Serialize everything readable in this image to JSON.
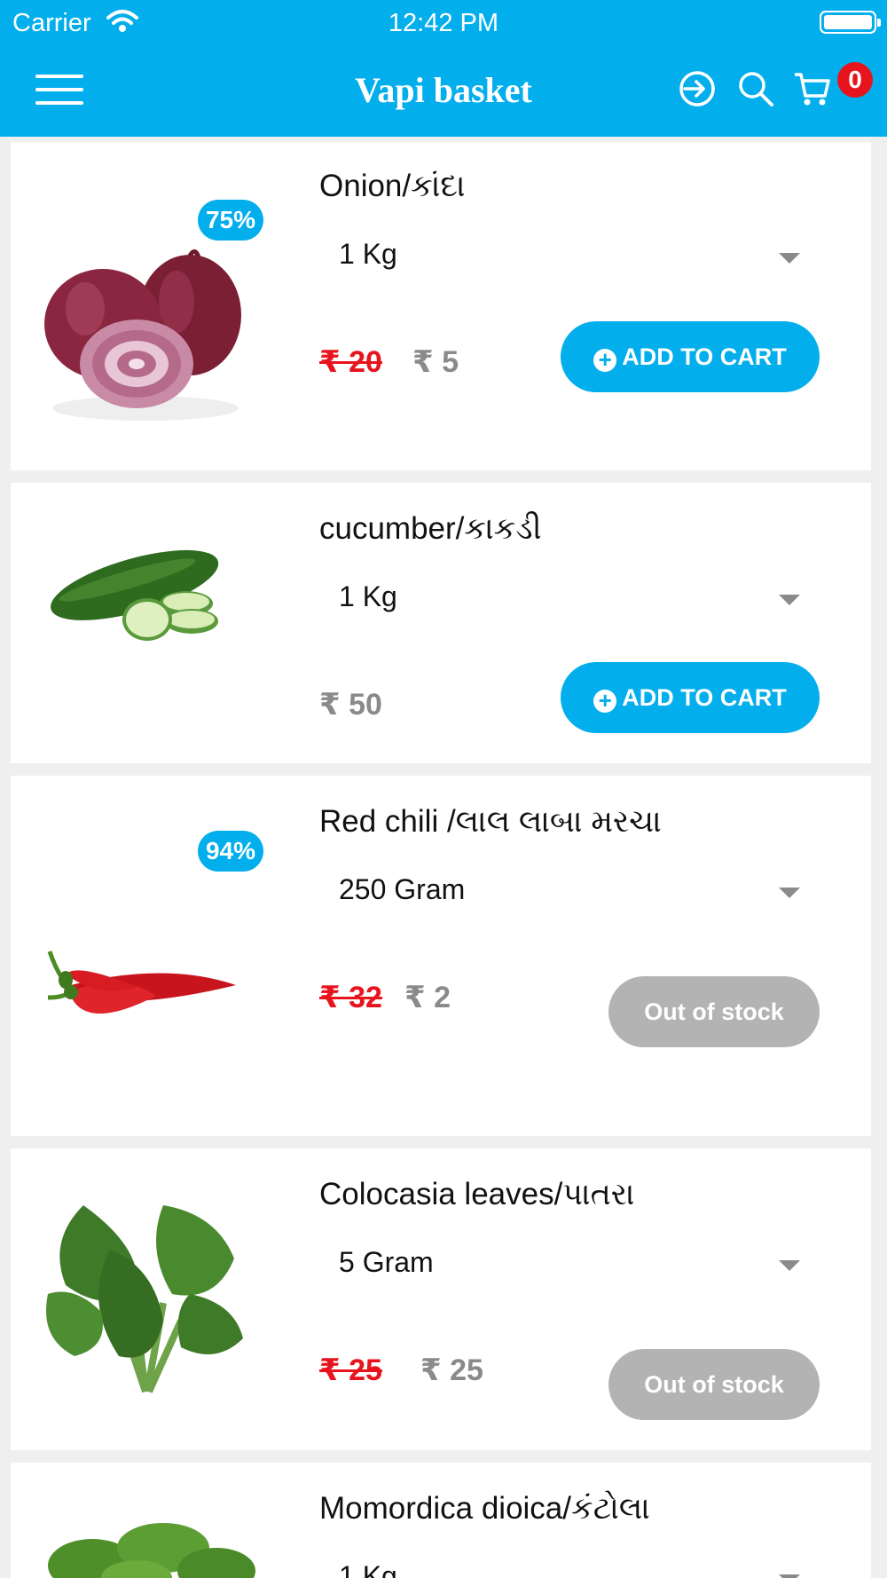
{
  "status_bar": {
    "carrier": "Carrier",
    "time": "12:42 PM"
  },
  "header": {
    "title": "Vapi basket",
    "cart_count": "0"
  },
  "products": [
    {
      "name": "Onion/કાંદા",
      "discount": "75%",
      "quantity": "1 Kg",
      "old_price": "₹ 20",
      "price": "₹ 5",
      "button": "ADD TO CART"
    },
    {
      "name": "cucumber/કાકડી",
      "quantity": "1 Kg",
      "price": "₹ 50",
      "button": "ADD TO CART"
    },
    {
      "name": "Red chili /લાલ લાબા મરચા",
      "discount": "94%",
      "quantity": "250 Gram",
      "old_price": "₹ 32",
      "price": "₹ 2",
      "button": "Out of stock"
    },
    {
      "name": "Colocasia leaves/પાતરા",
      "quantity": "5 Gram",
      "old_price": "₹ 25",
      "price": "₹ 25",
      "button": "Out of stock"
    },
    {
      "name": "Momordica dioica/કંટોલા",
      "quantity": "1 Kg"
    }
  ],
  "colors": {
    "primary": "#03aeec",
    "badge_red": "#e8141d",
    "disabled": "#b3b3b3",
    "price_grey": "#8a8a8a"
  },
  "icons": [
    "menu-icon",
    "login-icon",
    "search-icon",
    "cart-icon",
    "plus-circle-icon",
    "dropdown-caret-icon"
  ]
}
